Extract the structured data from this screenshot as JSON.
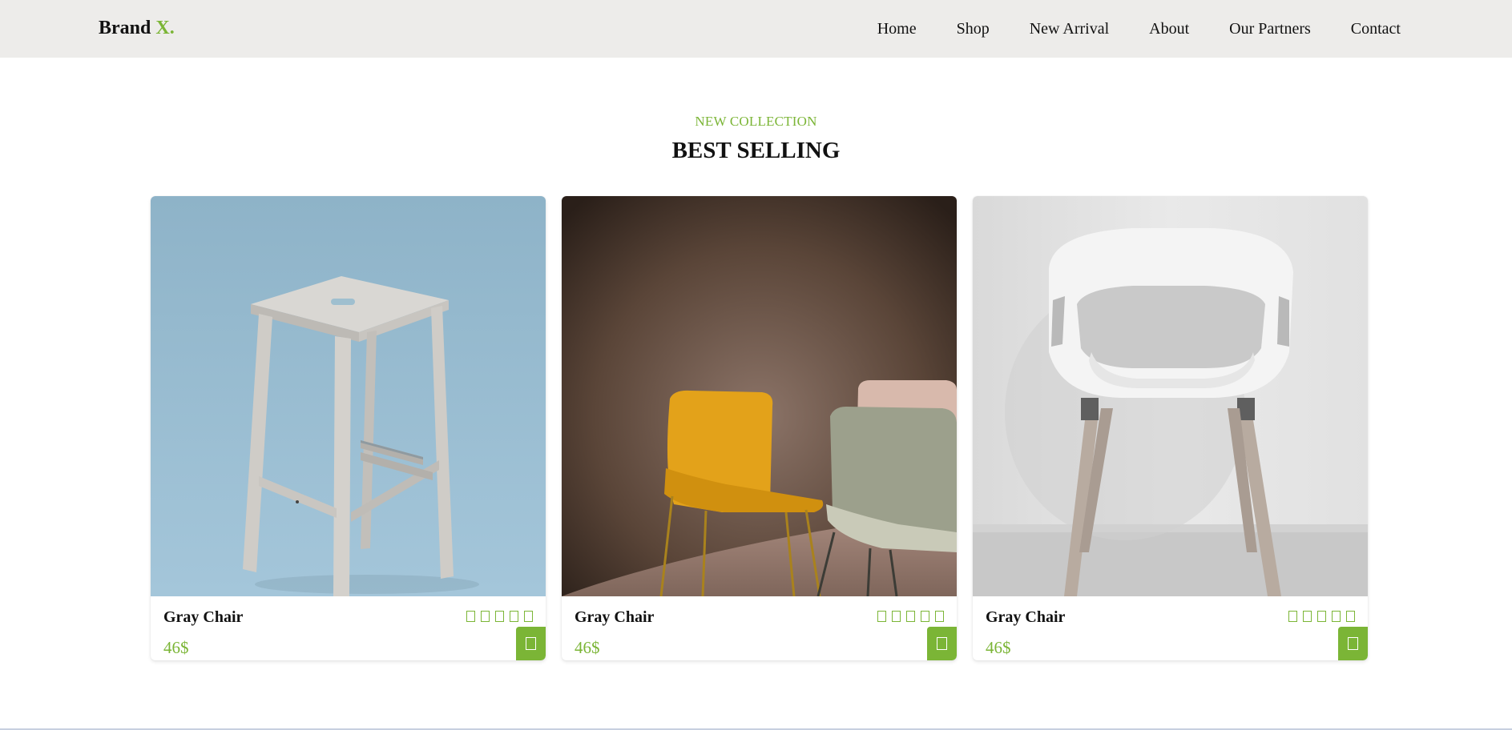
{
  "brand": {
    "name": "Brand",
    "accent": "X."
  },
  "nav": {
    "items": [
      {
        "label": "Home"
      },
      {
        "label": "Shop"
      },
      {
        "label": "New Arrival"
      },
      {
        "label": "About"
      },
      {
        "label": "Our Partners"
      },
      {
        "label": "Contact"
      }
    ]
  },
  "section": {
    "eyebrow": "NEW COLLECTION",
    "title": "BEST SELLING"
  },
  "colors": {
    "accent": "#7bb536",
    "nav_bg": "#edecea"
  },
  "products": [
    {
      "name": "Gray Chair",
      "price": "46$",
      "stars": 5,
      "image": "wooden-stool-photo",
      "cart_icon": "cart-icon"
    },
    {
      "name": "Gray Chair",
      "price": "46$",
      "stars": 5,
      "image": "yellow-and-green-chairs-photo",
      "cart_icon": "cart-icon"
    },
    {
      "name": "Gray Chair",
      "price": "46$",
      "stars": 5,
      "image": "white-chair-photo",
      "cart_icon": "cart-icon"
    }
  ]
}
